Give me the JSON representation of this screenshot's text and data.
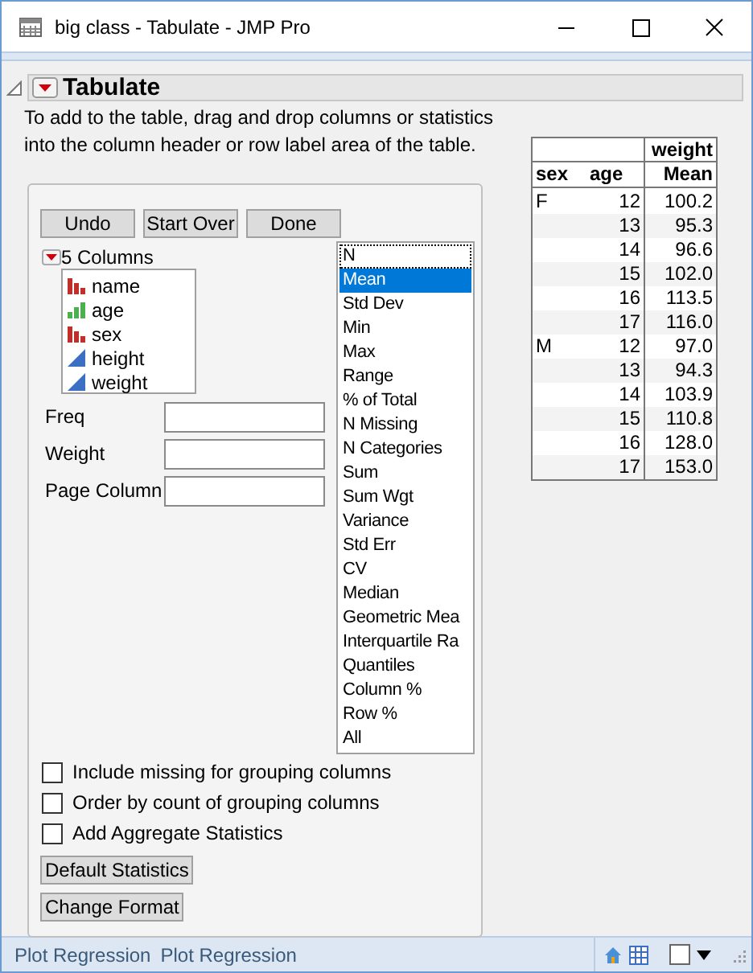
{
  "window": {
    "title": "big class - Tabulate - JMP Pro"
  },
  "outline": {
    "title": "Tabulate",
    "expanded": true
  },
  "instructions": "To add to the table, drag and drop columns or statistics into the column header or row label area of the table.",
  "buttons": [
    "Undo",
    "Start Over",
    "Done"
  ],
  "columns_header": "5 Columns",
  "columns": [
    {
      "name": "name",
      "kind": "nominal"
    },
    {
      "name": "age",
      "kind": "ordinal"
    },
    {
      "name": "sex",
      "kind": "nominal"
    },
    {
      "name": "height",
      "kind": "continuous"
    },
    {
      "name": "weight",
      "kind": "continuous"
    }
  ],
  "roles": [
    {
      "label": "Freq"
    },
    {
      "label": "Weight"
    },
    {
      "label": "Page Column"
    }
  ],
  "statistics": [
    {
      "label": "N",
      "selected": false,
      "focused": true
    },
    {
      "label": "Mean",
      "selected": true,
      "focused": false
    },
    {
      "label": "Std Dev",
      "selected": false,
      "focused": false
    },
    {
      "label": "Min",
      "selected": false,
      "focused": false
    },
    {
      "label": "Max",
      "selected": false,
      "focused": false
    },
    {
      "label": "Range",
      "selected": false,
      "focused": false
    },
    {
      "label": "% of Total",
      "selected": false,
      "focused": false
    },
    {
      "label": "N Missing",
      "selected": false,
      "focused": false
    },
    {
      "label": "N Categories",
      "selected": false,
      "focused": false
    },
    {
      "label": "Sum",
      "selected": false,
      "focused": false
    },
    {
      "label": "Sum Wgt",
      "selected": false,
      "focused": false
    },
    {
      "label": "Variance",
      "selected": false,
      "focused": false
    },
    {
      "label": "Std Err",
      "selected": false,
      "focused": false
    },
    {
      "label": "CV",
      "selected": false,
      "focused": false
    },
    {
      "label": "Median",
      "selected": false,
      "focused": false
    },
    {
      "label": "Geometric Mea",
      "selected": false,
      "focused": false
    },
    {
      "label": "Interquartile Ra",
      "selected": false,
      "focused": false
    },
    {
      "label": "Quantiles",
      "selected": false,
      "focused": false
    },
    {
      "label": "Column %",
      "selected": false,
      "focused": false
    },
    {
      "label": "Row %",
      "selected": false,
      "focused": false
    },
    {
      "label": "All",
      "selected": false,
      "focused": false
    }
  ],
  "options": [
    {
      "label": "Include missing for grouping columns",
      "checked": false
    },
    {
      "label": "Order by count of grouping columns",
      "checked": false
    },
    {
      "label": "Add Aggregate Statistics",
      "checked": false
    }
  ],
  "bottom_buttons": [
    "Default Statistics",
    "Change Format"
  ],
  "table": {
    "column_group": "weight",
    "columns": [
      "sex",
      "age",
      "Mean"
    ],
    "rows": [
      {
        "sex": "F",
        "age": "12",
        "value": "100.2"
      },
      {
        "age": "13",
        "value": "95.3"
      },
      {
        "age": "14",
        "value": "96.6"
      },
      {
        "age": "15",
        "value": "102.0"
      },
      {
        "age": "16",
        "value": "113.5"
      },
      {
        "age": "17",
        "value": "116.0"
      },
      {
        "sex": "M",
        "age": "12",
        "value": "97.0"
      },
      {
        "age": "13",
        "value": "94.3"
      },
      {
        "age": "14",
        "value": "103.9"
      },
      {
        "age": "15",
        "value": "110.8"
      },
      {
        "age": "16",
        "value": "128.0"
      },
      {
        "age": "17",
        "value": "153.0"
      }
    ]
  },
  "status_bar": {
    "items": [
      "Plot Regression",
      "Plot Regression"
    ]
  }
}
